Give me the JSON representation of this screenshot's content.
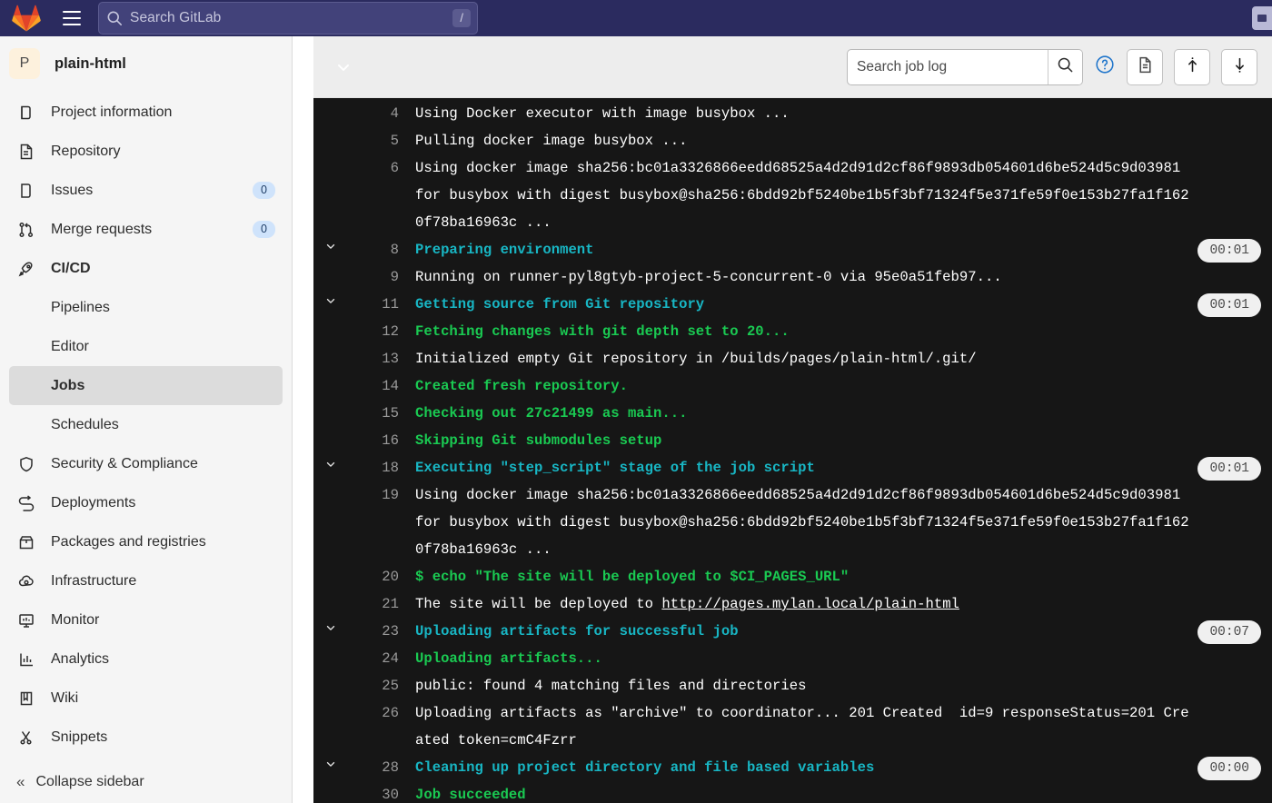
{
  "navbar": {
    "logo_icon": "gitlab-logo-icon",
    "menu_icon": "hamburger-menu-icon",
    "search_placeholder": "Search GitLab",
    "search_value": "",
    "search_icon": "search-icon",
    "slash_shortcut": "/"
  },
  "sidebar": {
    "project": {
      "avatar_letter": "P",
      "name": "plain-html"
    },
    "items": [
      {
        "label": "Project information",
        "icon": "project-information-icon",
        "badge": null,
        "bold": false
      },
      {
        "label": "Repository",
        "icon": "repository-icon",
        "badge": null,
        "bold": false
      },
      {
        "label": "Issues",
        "icon": "issues-icon",
        "badge": "0",
        "bold": false
      },
      {
        "label": "Merge requests",
        "icon": "merge-requests-icon",
        "badge": "0",
        "bold": false
      },
      {
        "label": "CI/CD",
        "icon": "rocket-icon",
        "badge": null,
        "bold": true
      }
    ],
    "cicd_subitems": [
      {
        "label": "Pipelines",
        "active": false
      },
      {
        "label": "Editor",
        "active": false
      },
      {
        "label": "Jobs",
        "active": true
      },
      {
        "label": "Schedules",
        "active": false
      }
    ],
    "items_after": [
      {
        "label": "Security & Compliance",
        "icon": "shield-icon"
      },
      {
        "label": "Deployments",
        "icon": "deployments-icon"
      },
      {
        "label": "Packages and registries",
        "icon": "package-icon"
      },
      {
        "label": "Infrastructure",
        "icon": "infrastructure-cloud-icon"
      },
      {
        "label": "Monitor",
        "icon": "monitor-icon"
      },
      {
        "label": "Analytics",
        "icon": "analytics-chart-icon"
      },
      {
        "label": "Wiki",
        "icon": "wiki-book-icon"
      },
      {
        "label": "Snippets",
        "icon": "snippets-scissors-icon"
      }
    ],
    "collapse_label": "Collapse sidebar",
    "collapse_icon": "double-chevron-left-icon"
  },
  "log_toolbar": {
    "collapse_chevron_icon": "chevron-down-icon",
    "search_placeholder": "Search job log",
    "search_value": "",
    "search_button_icon": "search-icon",
    "help_icon": "question-circle-icon",
    "raw_icon": "file-document-icon",
    "scroll_top_icon": "scroll-to-top-icon",
    "scroll_bottom_icon": "scroll-to-bottom-icon"
  },
  "colors": {
    "navbar_bg": "#2b2b5f",
    "log_bg": "#161616",
    "cyan": "#18b6c4",
    "green": "#1aca52",
    "white": "#ffffff",
    "badge_blue": "#cfe3fb"
  },
  "log": {
    "lines": [
      {
        "no": "4",
        "collapsible": false,
        "color": "white",
        "text": "Using Docker executor with image busybox ...",
        "duration": null
      },
      {
        "no": "5",
        "collapsible": false,
        "color": "white",
        "text": "Pulling docker image busybox ...",
        "duration": null
      },
      {
        "no": "6",
        "collapsible": false,
        "color": "white",
        "text": "Using docker image sha256:bc01a3326866eedd68525a4d2d91d2cf86f9893db054601d6be524d5c9d03981 for busybox with digest busybox@sha256:6bdd92bf5240be1b5f3bf71324f5e371fe59f0e153b27fa1f1620f78ba16963c ...",
        "duration": null
      },
      {
        "no": "8",
        "collapsible": true,
        "color": "cyan",
        "text": "Preparing environment",
        "duration": "00:01"
      },
      {
        "no": "9",
        "collapsible": false,
        "color": "white",
        "text": "Running on runner-pyl8gtyb-project-5-concurrent-0 via 95e0a51feb97...",
        "duration": null
      },
      {
        "no": "11",
        "collapsible": true,
        "color": "cyan",
        "text": "Getting source from Git repository",
        "duration": "00:01"
      },
      {
        "no": "12",
        "collapsible": false,
        "color": "green",
        "text": "Fetching changes with git depth set to 20...",
        "duration": null
      },
      {
        "no": "13",
        "collapsible": false,
        "color": "white",
        "text": "Initialized empty Git repository in /builds/pages/plain-html/.git/",
        "duration": null
      },
      {
        "no": "14",
        "collapsible": false,
        "color": "green",
        "text": "Created fresh repository.",
        "duration": null
      },
      {
        "no": "15",
        "collapsible": false,
        "color": "green",
        "text": "Checking out 27c21499 as main...",
        "duration": null
      },
      {
        "no": "16",
        "collapsible": false,
        "color": "green",
        "text": "Skipping Git submodules setup",
        "duration": null
      },
      {
        "no": "18",
        "collapsible": true,
        "color": "cyan",
        "text": "Executing \"step_script\" stage of the job script",
        "duration": "00:01"
      },
      {
        "no": "19",
        "collapsible": false,
        "color": "white",
        "text": "Using docker image sha256:bc01a3326866eedd68525a4d2d91d2cf86f9893db054601d6be524d5c9d03981 for busybox with digest busybox@sha256:6bdd92bf5240be1b5f3bf71324f5e371fe59f0e153b27fa1f1620f78ba16963c ...",
        "duration": null
      },
      {
        "no": "20",
        "collapsible": false,
        "color": "green",
        "text": "$ echo \"The site will be deployed to $CI_PAGES_URL\"",
        "duration": null
      },
      {
        "no": "21",
        "collapsible": false,
        "color": "white",
        "text": "The site will be deployed to ",
        "link": "http://pages.mylan.local/plain-html",
        "duration": null
      },
      {
        "no": "23",
        "collapsible": true,
        "color": "cyan",
        "text": "Uploading artifacts for successful job",
        "duration": "00:07"
      },
      {
        "no": "24",
        "collapsible": false,
        "color": "green",
        "text": "Uploading artifacts...",
        "duration": null
      },
      {
        "no": "25",
        "collapsible": false,
        "color": "white",
        "text": "public: found 4 matching files and directories",
        "duration": null
      },
      {
        "no": "26",
        "collapsible": false,
        "color": "white",
        "text": "Uploading artifacts as \"archive\" to coordinator... 201 Created  id=9 responseStatus=201 Created token=cmC4Fzrr",
        "duration": null
      },
      {
        "no": "28",
        "collapsible": true,
        "color": "cyan",
        "text": "Cleaning up project directory and file based variables",
        "duration": "00:00"
      },
      {
        "no": "30",
        "collapsible": false,
        "color": "green",
        "text": "Job succeeded",
        "duration": null
      }
    ]
  }
}
